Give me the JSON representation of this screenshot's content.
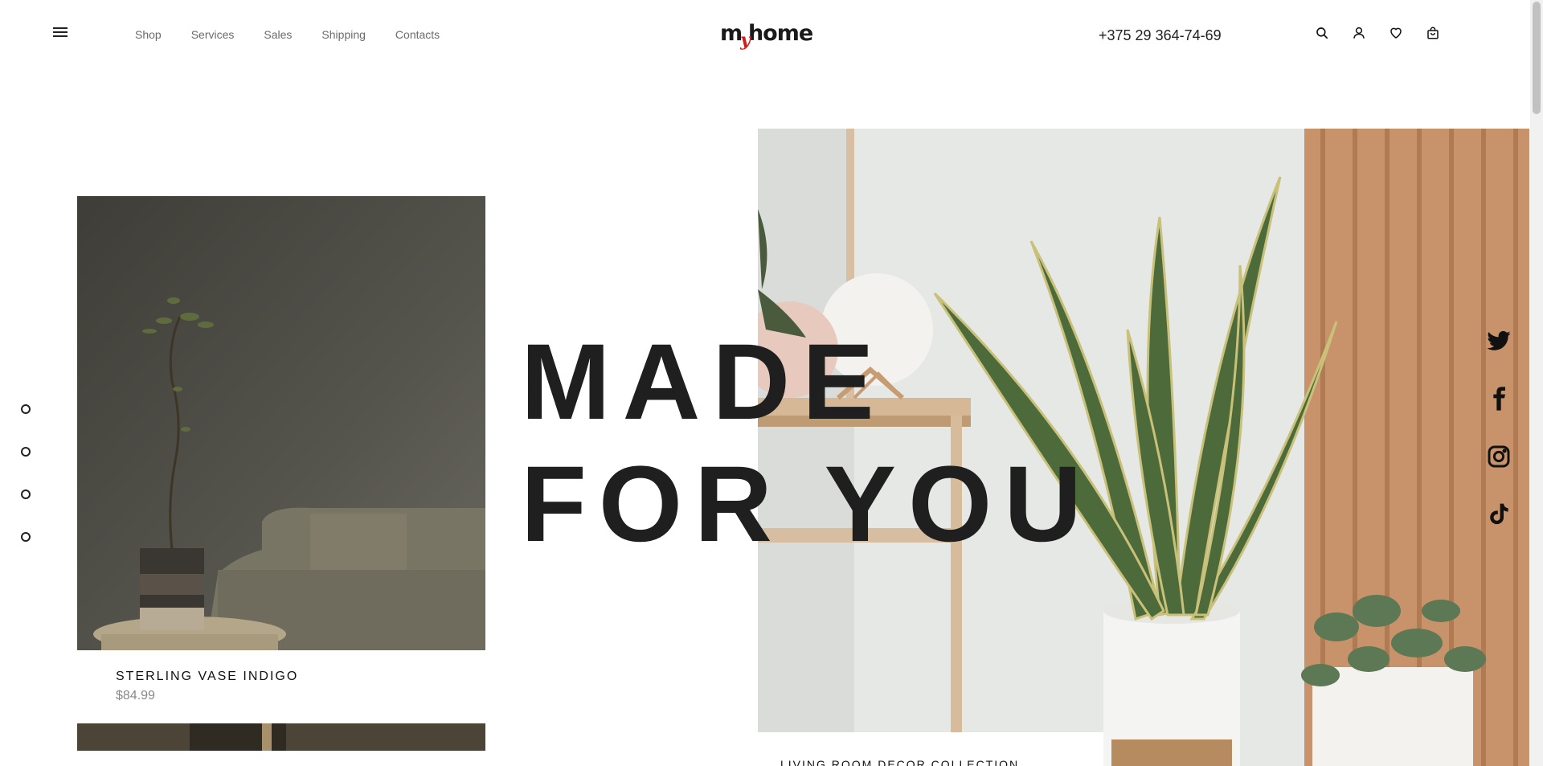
{
  "header": {
    "nav": [
      "Shop",
      "Services",
      "Sales",
      "Shipping",
      "Contacts"
    ],
    "logo": {
      "left": "m",
      "middle": "y",
      "right": "home"
    },
    "phone": "+375 29 364-74-69",
    "icons": [
      "search-icon",
      "user-icon",
      "heart-icon",
      "cart-icon"
    ],
    "accent": "#d21b1b"
  },
  "slider": {
    "dots": 4
  },
  "hero": {
    "headline_line1": "MADE",
    "headline_line2": "FOR YOU"
  },
  "product": {
    "name": "STERLING VASE INDIGO",
    "price": "$84.99"
  },
  "collection": {
    "caption": "LIVING ROOM DECOR COLLECTION"
  },
  "social": [
    "twitter-icon",
    "facebook-icon",
    "instagram-icon",
    "tiktok-icon"
  ]
}
